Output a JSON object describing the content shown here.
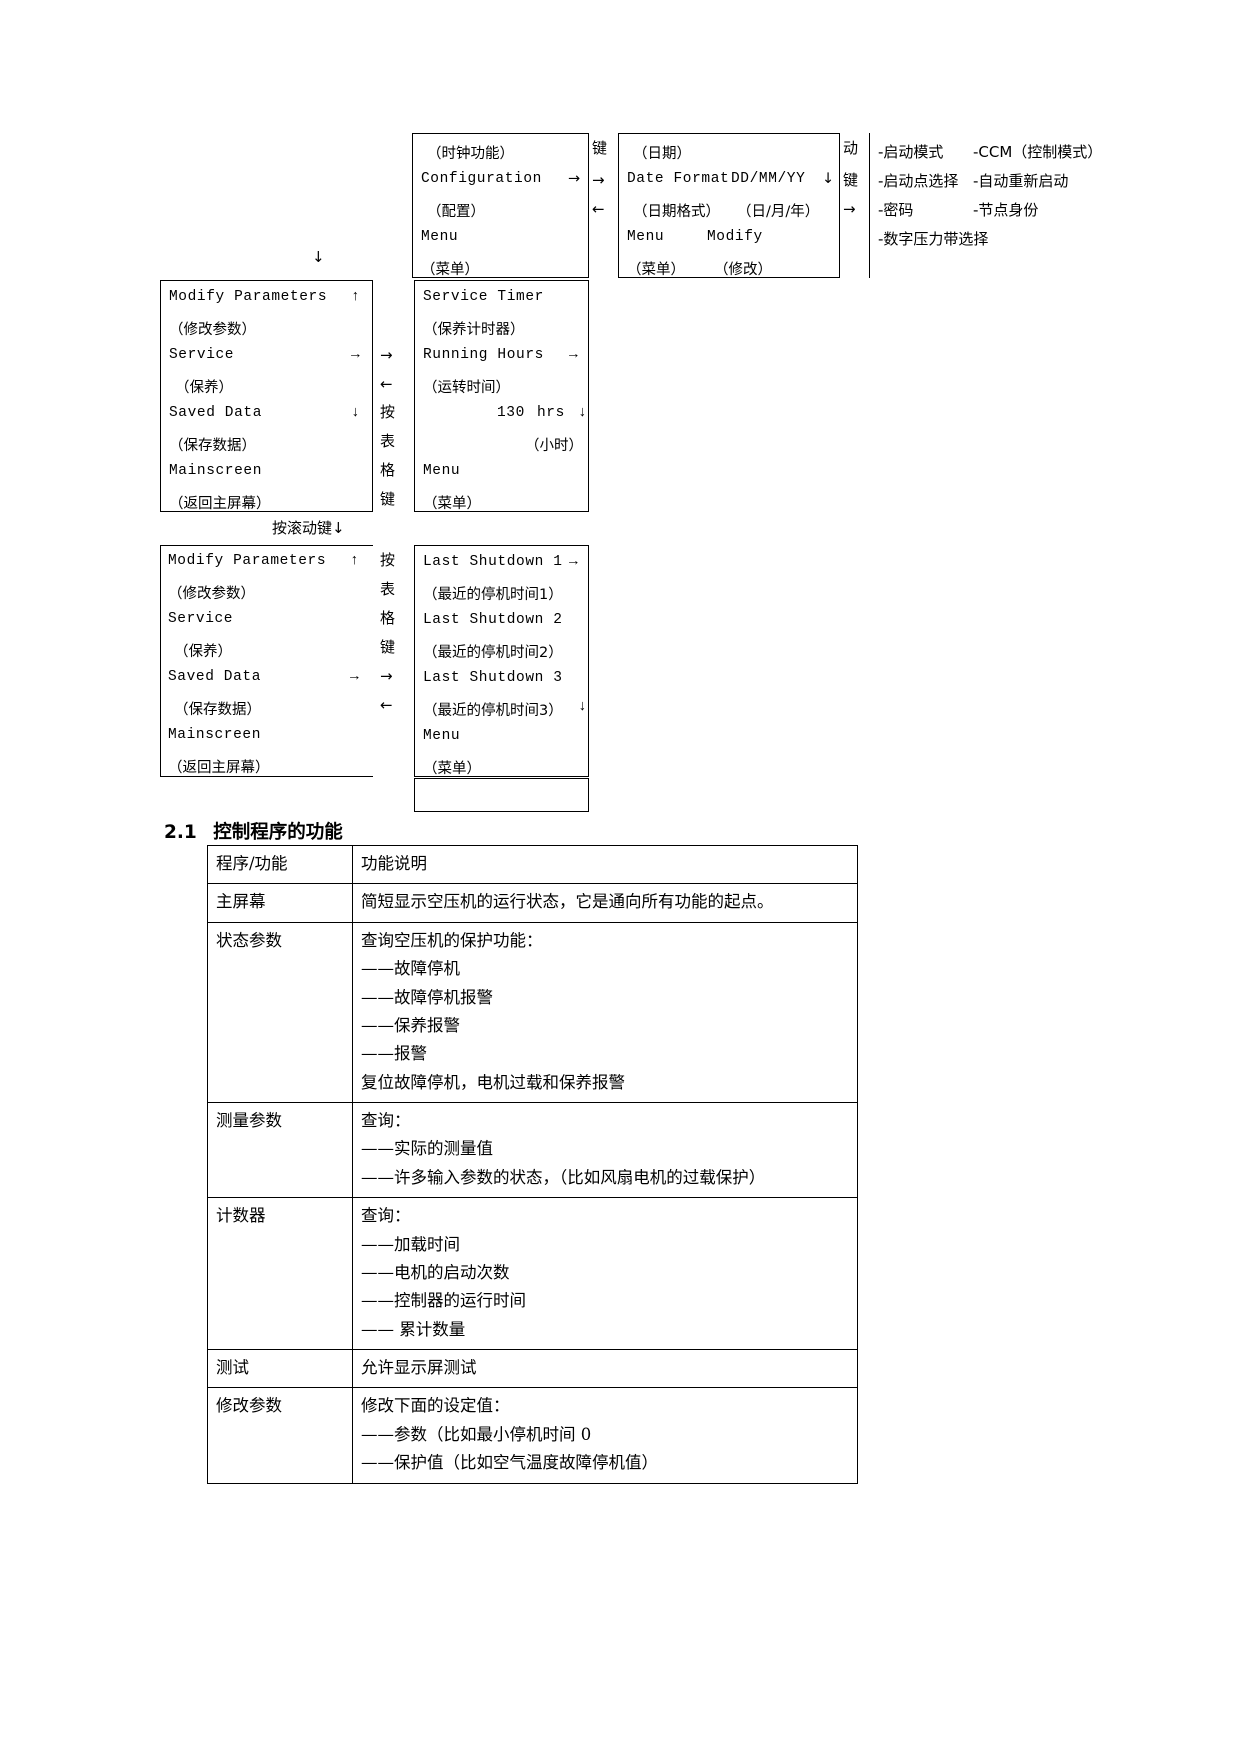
{
  "diagram": {
    "config_box": {
      "lines": [
        "（时钟功能）",
        "Configuration",
        "（配置）",
        "Menu",
        "（菜单）"
      ],
      "arrow_right": "→"
    },
    "connector_1": {
      "label_char": "键",
      "arrow_right": "→",
      "arrow_left": "←"
    },
    "date_box": {
      "line1": "（日期）",
      "line2_left": "Date Format",
      "line2_right": "DD/MM/YY",
      "line2_arrow": "↓",
      "line3_left": "（日期格式）",
      "line3_right": "（日/月/年）",
      "line4_left": "Menu",
      "line4_right": "Modify",
      "line5_left": "（菜单）",
      "line5_right": "（修改）"
    },
    "connector_2": {
      "char1": "动",
      "char2": "键",
      "arrow_right": "→"
    },
    "param_list": {
      "rows": [
        {
          "left": "-启动模式",
          "right": "-CCM（控制模式）"
        },
        {
          "left": "-启动点选择",
          "right": "-自动重新启动"
        },
        {
          "left": "-密码",
          "right": "-节点身份"
        },
        {
          "left": "-数字压力带选择",
          "right": ""
        }
      ]
    },
    "down_arrow_1": "↓",
    "menu_box_1": {
      "lines": [
        {
          "text": "Modify Parameters",
          "mark": "↑"
        },
        {
          "text": "（修改参数）",
          "mark": ""
        },
        {
          "text": "Service",
          "mark": "→"
        },
        {
          "text": "（保养）",
          "mark": ""
        },
        {
          "text": "Saved Data",
          "mark": "↓"
        },
        {
          "text": "（保存数据）",
          "mark": ""
        },
        {
          "text": "Mainscreen",
          "mark": ""
        },
        {
          "text": "（返回主屏幕）",
          "mark": ""
        }
      ]
    },
    "connector_3": {
      "arrow_right": "→",
      "arrow_left": "←",
      "chars": [
        "按",
        "表",
        "格",
        "键"
      ]
    },
    "service_box": {
      "line1": "Service Timer",
      "line2": "（保养计时器）",
      "line3": "Running Hours",
      "line3_arrow": "→",
      "line4": "（运转时间）",
      "line5_value": "130",
      "line5_unit": "hrs",
      "line5_arrow": "↓",
      "line6": "（小时）",
      "line7": "Menu",
      "line8": "（菜单）"
    },
    "scroll_note": "按滚动键↓",
    "menu_box_2": {
      "lines": [
        {
          "text": "Modify Parameters",
          "mark": "↑"
        },
        {
          "text": "（修改参数）",
          "mark": ""
        },
        {
          "text": "Service",
          "mark": ""
        },
        {
          "text": "（保养）",
          "mark": ""
        },
        {
          "text": "Saved Data",
          "mark": "→"
        },
        {
          "text": "（保存数据）",
          "mark": ""
        },
        {
          "text": "Mainscreen",
          "mark": ""
        },
        {
          "text": "（返回主屏幕）",
          "mark": ""
        }
      ]
    },
    "connector_4": {
      "chars": [
        "按",
        "表",
        "格",
        "键"
      ],
      "arrow_right": "→",
      "arrow_left": "←"
    },
    "shutdown_box": {
      "line1": "Last Shutdown 1",
      "line1_arrow": "→",
      "line2": "（最近的停机时间1）",
      "line3": "Last Shutdown 2",
      "line4": "（最近的停机时间2）",
      "line5": "Last Shutdown 3",
      "line6": "（最近的停机时间3）",
      "line6_arrow": "↓",
      "line7": "Menu",
      "line8": "（菜单）"
    }
  },
  "section": {
    "number": "2.1",
    "title": "控制程序的功能"
  },
  "table": {
    "header": {
      "col1": "程序/功能",
      "col2": "功能说明"
    },
    "rows": [
      {
        "name": "主屏幕",
        "lines": [
          {
            "text": "简短显示空压机的运行状态，它是通向所有功能的起点。",
            "indent": false
          }
        ]
      },
      {
        "name": "状态参数",
        "lines": [
          {
            "text": "查询空压机的保护功能：",
            "indent": false
          },
          {
            "text": "——故障停机",
            "indent": false
          },
          {
            "text": "——故障停机报警",
            "indent": false
          },
          {
            "text": "——保养报警",
            "indent": false
          },
          {
            "text": "——报警",
            "indent": false
          },
          {
            "text": "复位故障停机，电机过载和保养报警",
            "indent": false
          }
        ]
      },
      {
        "name": "测量参数",
        "lines": [
          {
            "text": "查询：",
            "indent": false
          },
          {
            "text": "——实际的测量值",
            "indent": false
          },
          {
            "text": "——许多输入参数的状态，（比如风扇电机的过载保护）",
            "indent": false
          }
        ]
      },
      {
        "name": "计数器",
        "lines": [
          {
            "text": "查询：",
            "indent": false
          },
          {
            "text": "——加载时间",
            "indent": false
          },
          {
            "text": "——电机的启动次数",
            "indent": false
          },
          {
            "text": "——控制器的运行时间",
            "indent": false
          },
          {
            "text": "—— 累计数量",
            "indent": false
          }
        ]
      },
      {
        "name": "测试",
        "lines": [
          {
            "text": "允许显示屏测试",
            "indent": false
          }
        ]
      },
      {
        "name": "修改参数",
        "lines": [
          {
            "text": "修改下面的设定值：",
            "indent": false
          },
          {
            "text": "——参数（比如最小停机时间 0",
            "indent": false
          },
          {
            "text": "——保护值（比如空气温度故障停机值）",
            "indent": false
          }
        ]
      }
    ]
  }
}
